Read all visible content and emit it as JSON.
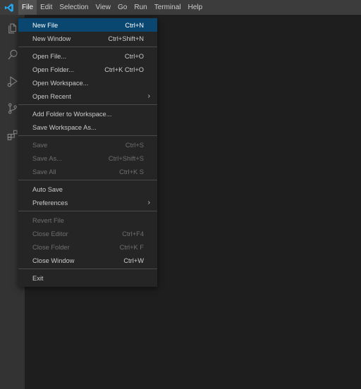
{
  "menubar": {
    "items": [
      "File",
      "Edit",
      "Selection",
      "View",
      "Go",
      "Run",
      "Terminal",
      "Help"
    ],
    "active": "File"
  },
  "activity_icons": [
    "explorer-icon",
    "search-icon",
    "run-debug-icon",
    "source-control-icon",
    "extensions-icon"
  ],
  "file_menu": {
    "groups": [
      [
        {
          "label": "New File",
          "shortcut": "Ctrl+N",
          "highlighted": true
        },
        {
          "label": "New Window",
          "shortcut": "Ctrl+Shift+N"
        }
      ],
      [
        {
          "label": "Open File...",
          "shortcut": "Ctrl+O"
        },
        {
          "label": "Open Folder...",
          "shortcut": "Ctrl+K Ctrl+O"
        },
        {
          "label": "Open Workspace...",
          "shortcut": ""
        },
        {
          "label": "Open Recent",
          "shortcut": "",
          "submenu": true
        }
      ],
      [
        {
          "label": "Add Folder to Workspace...",
          "shortcut": ""
        },
        {
          "label": "Save Workspace As...",
          "shortcut": ""
        }
      ],
      [
        {
          "label": "Save",
          "shortcut": "Ctrl+S",
          "disabled": true
        },
        {
          "label": "Save As...",
          "shortcut": "Ctrl+Shift+S",
          "disabled": true
        },
        {
          "label": "Save All",
          "shortcut": "Ctrl+K S",
          "disabled": true
        }
      ],
      [
        {
          "label": "Auto Save",
          "shortcut": ""
        },
        {
          "label": "Preferences",
          "shortcut": "",
          "submenu": true
        }
      ],
      [
        {
          "label": "Revert File",
          "shortcut": "",
          "disabled": true
        },
        {
          "label": "Close Editor",
          "shortcut": "Ctrl+F4",
          "disabled": true
        },
        {
          "label": "Close Folder",
          "shortcut": "Ctrl+K F",
          "disabled": true
        },
        {
          "label": "Close Window",
          "shortcut": "Ctrl+W"
        }
      ],
      [
        {
          "label": "Exit",
          "shortcut": ""
        }
      ]
    ]
  },
  "colors": {
    "accent_logo": "#23a9f2",
    "highlight": "#094771",
    "menubar_bg": "#3c3c3c",
    "activity_bg": "#333333",
    "editor_bg": "#1e1e1e",
    "menu_bg": "#252526"
  }
}
